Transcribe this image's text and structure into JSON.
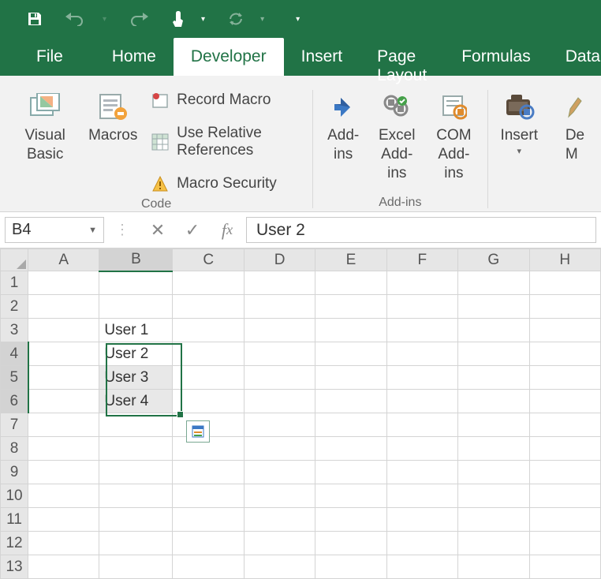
{
  "qat": {
    "save": "save-icon",
    "undo": "undo-icon",
    "redo": "redo-icon",
    "touch": "touch-mode-icon",
    "refresh": "refresh-icon"
  },
  "tabs": {
    "file": "File",
    "home": "Home",
    "developer": "Developer",
    "insert": "Insert",
    "page_layout": "Page Layout",
    "formulas": "Formulas",
    "data": "Data",
    "active": "developer"
  },
  "ribbon": {
    "code": {
      "label": "Code",
      "visual_basic": "Visual Basic",
      "macros": "Macros",
      "record_macro": "Record Macro",
      "use_relative": "Use Relative References",
      "macro_security": "Macro Security"
    },
    "addins": {
      "label": "Add-ins",
      "addins": "Add-ins",
      "excel_addins": "Excel Add-ins",
      "com_addins": "COM Add-ins"
    },
    "controls": {
      "insert": "Insert",
      "design_mode_partial": "De"
    }
  },
  "formula_bar": {
    "name_box": "B4",
    "formula": "User 2"
  },
  "grid": {
    "columns": [
      "A",
      "B",
      "C",
      "D",
      "E",
      "F",
      "G",
      "H"
    ],
    "rows": 13,
    "cells": {
      "B3": "User 1",
      "B4": "User 2",
      "B5": "User 3",
      "B6": "User 4"
    },
    "selection": {
      "active_cell": "B4",
      "range_rows": [
        4,
        5,
        6
      ],
      "range_col": "B"
    }
  }
}
